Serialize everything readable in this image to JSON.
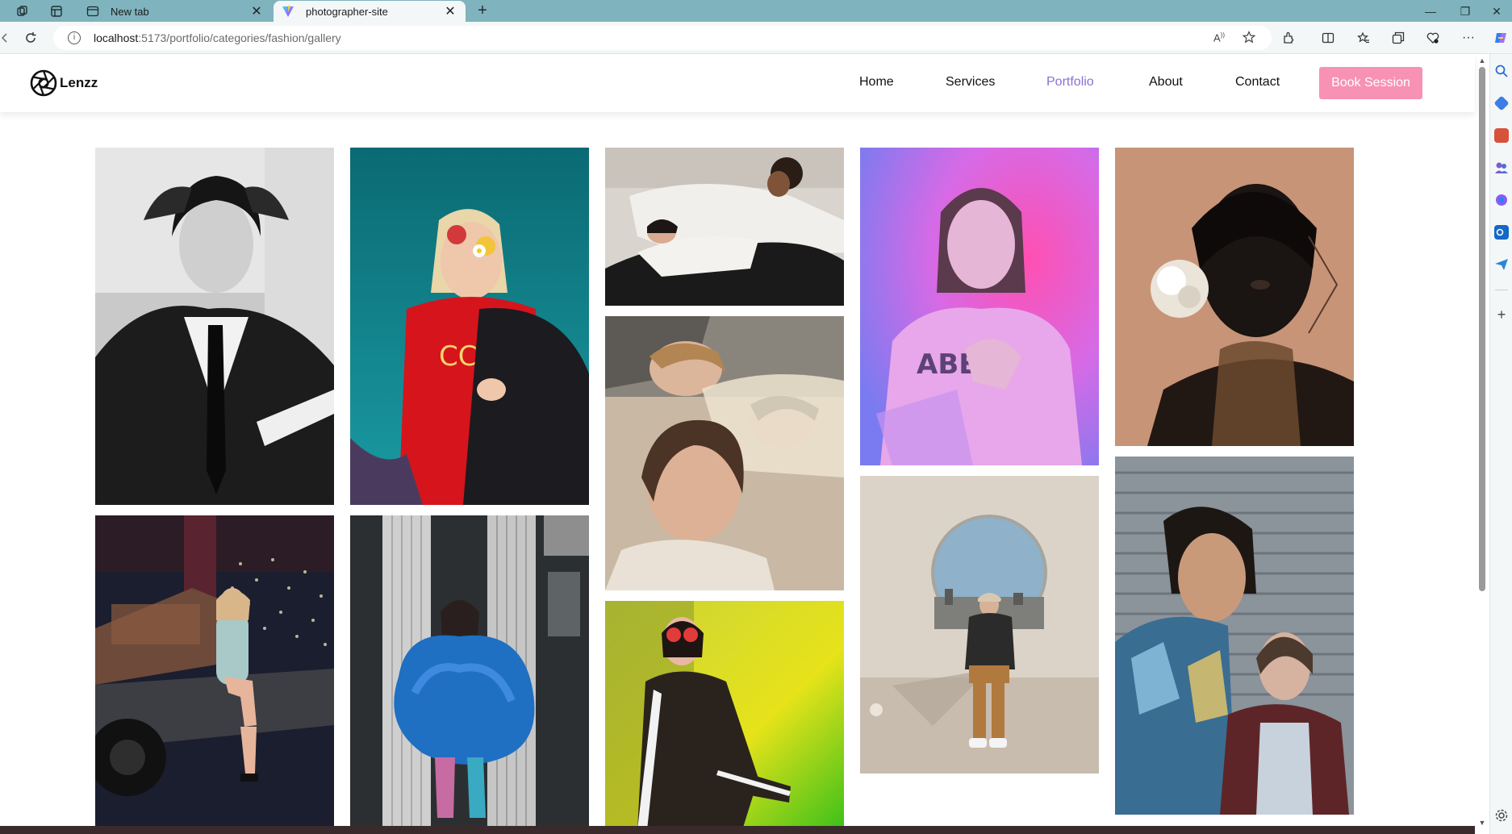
{
  "browser": {
    "tabs": [
      {
        "title": "New tab",
        "active": false
      },
      {
        "title": "photographer-site",
        "active": true
      }
    ],
    "address": {
      "host": "localhost",
      "path": ":5173/portfolio/categories/fashion/gallery"
    }
  },
  "site": {
    "logo_text": "Lenzz",
    "nav": {
      "home": "Home",
      "services": "Services",
      "portfolio": "Portfolio",
      "about": "About",
      "contact": "Contact",
      "active": "Portfolio"
    },
    "cta_label": "Book Session",
    "colors": {
      "accent": "#8a6fd6",
      "cta": "#f792b5"
    }
  },
  "gallery": {
    "category": "fashion",
    "photos": [
      {
        "name": "photo-woman-black-white-suit-tie"
      },
      {
        "name": "photo-blonde-woman-heart-sunglasses-teal-sky"
      },
      {
        "name": "photo-two-women-white-outfits-lying"
      },
      {
        "name": "photo-woman-neon-pink-light"
      },
      {
        "name": "photo-woman-white-flower-earring"
      },
      {
        "name": "photo-group-lying-on-bed"
      },
      {
        "name": "photo-woman-sitting-truck-city-lights"
      },
      {
        "name": "photo-woman-blue-tulle-dress-columns"
      },
      {
        "name": "photo-woman-red-glasses-green-background"
      },
      {
        "name": "photo-man-sitting-circular-window"
      },
      {
        "name": "photo-two-people-corrugated-wall"
      }
    ]
  }
}
